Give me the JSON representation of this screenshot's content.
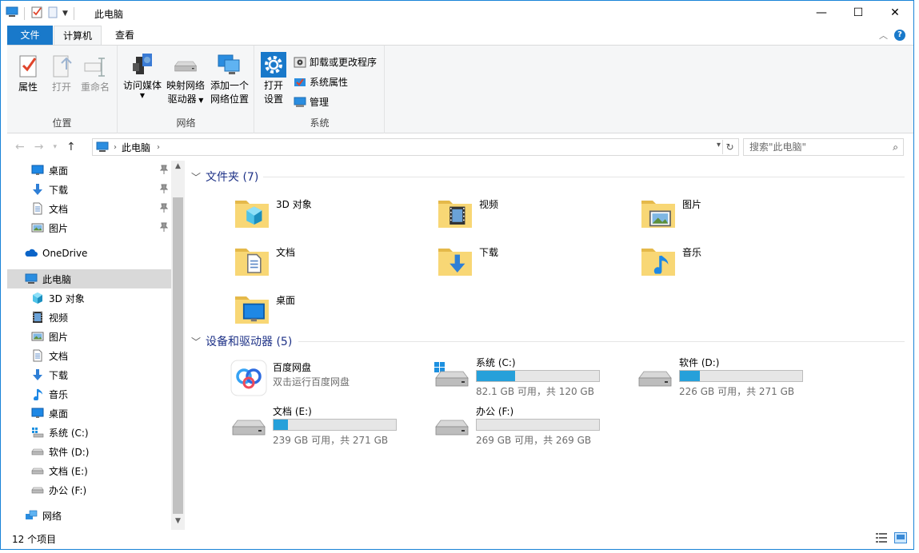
{
  "window": {
    "title": "此电脑",
    "controls": {
      "minimize": "—",
      "maximize": "☐",
      "close": "✕"
    }
  },
  "tabs": [
    {
      "label": "文件"
    },
    {
      "label": "计算机"
    },
    {
      "label": "查看"
    }
  ],
  "ribbon": {
    "groups": {
      "location": {
        "label": "位置",
        "buttons": [
          {
            "label": "属性"
          },
          {
            "label": "打开"
          },
          {
            "label": "重命名"
          }
        ]
      },
      "network": {
        "label": "网络",
        "buttons": [
          {
            "label": "访问媒体"
          },
          {
            "label_line1": "映射网络",
            "label_line2": "驱动器"
          },
          {
            "label_line1": "添加一个",
            "label_line2": "网络位置"
          }
        ]
      },
      "system": {
        "label": "系统",
        "open_settings_line1": "打开",
        "open_settings_line2": "设置",
        "small": [
          {
            "label": "卸载或更改程序"
          },
          {
            "label": "系统属性"
          },
          {
            "label": "管理"
          }
        ]
      }
    }
  },
  "address": {
    "path": "此电脑",
    "search_placeholder": "搜索\"此电脑\""
  },
  "nav": {
    "quick": [
      {
        "label": "桌面",
        "icon": "desktop-icon"
      },
      {
        "label": "下载",
        "icon": "download-icon"
      },
      {
        "label": "文档",
        "icon": "document-icon"
      },
      {
        "label": "图片",
        "icon": "picture-icon"
      }
    ],
    "onedrive": "OneDrive",
    "this_pc": "此电脑",
    "pc_items": [
      {
        "label": "3D 对象",
        "icon": "3d-objects-icon"
      },
      {
        "label": "视频",
        "icon": "video-icon"
      },
      {
        "label": "图片",
        "icon": "picture-icon"
      },
      {
        "label": "文档",
        "icon": "document-icon"
      },
      {
        "label": "下载",
        "icon": "download-icon"
      },
      {
        "label": "音乐",
        "icon": "music-icon"
      },
      {
        "label": "桌面",
        "icon": "desktop-icon"
      },
      {
        "label": "系统 (C:)",
        "icon": "system-drive-icon"
      },
      {
        "label": "软件 (D:)",
        "icon": "drive-icon"
      },
      {
        "label": "文档 (E:)",
        "icon": "drive-icon"
      },
      {
        "label": "办公 (F:)",
        "icon": "drive-icon"
      }
    ],
    "network": "网络"
  },
  "content": {
    "folders_header": "文件夹 (7)",
    "folders": [
      {
        "name": "3D 对象",
        "icon": "3d-objects-folder-icon"
      },
      {
        "name": "视频",
        "icon": "video-folder-icon"
      },
      {
        "name": "图片",
        "icon": "picture-folder-icon"
      },
      {
        "name": "文档",
        "icon": "document-folder-icon"
      },
      {
        "name": "下载",
        "icon": "download-folder-icon"
      },
      {
        "name": "音乐",
        "icon": "music-folder-icon"
      },
      {
        "name": "桌面",
        "icon": "desktop-folder-icon"
      }
    ],
    "devices_header": "设备和驱动器 (5)",
    "baidu": {
      "name": "百度网盘",
      "desc": "双击运行百度网盘"
    },
    "drives": [
      {
        "name": "系统 (C:)",
        "info": "82.1 GB 可用，共 120 GB",
        "used_fraction": 0.316,
        "icon": "system-drive-icon"
      },
      {
        "name": "软件 (D:)",
        "info": "226 GB 可用，共 271 GB",
        "used_fraction": 0.166,
        "icon": "drive-icon"
      },
      {
        "name": "文档 (E:)",
        "info": "239 GB 可用，共 271 GB",
        "used_fraction": 0.118,
        "icon": "drive-icon"
      },
      {
        "name": "办公 (F:)",
        "info": "269 GB 可用，共 269 GB",
        "used_fraction": 0.0,
        "icon": "drive-icon"
      }
    ]
  },
  "status": {
    "count": "12 个项目"
  },
  "colors": {
    "accent": "#1979ca",
    "folder": "#f8d775",
    "bar_fill": "#26a0da",
    "section_text": "#1e3287"
  }
}
